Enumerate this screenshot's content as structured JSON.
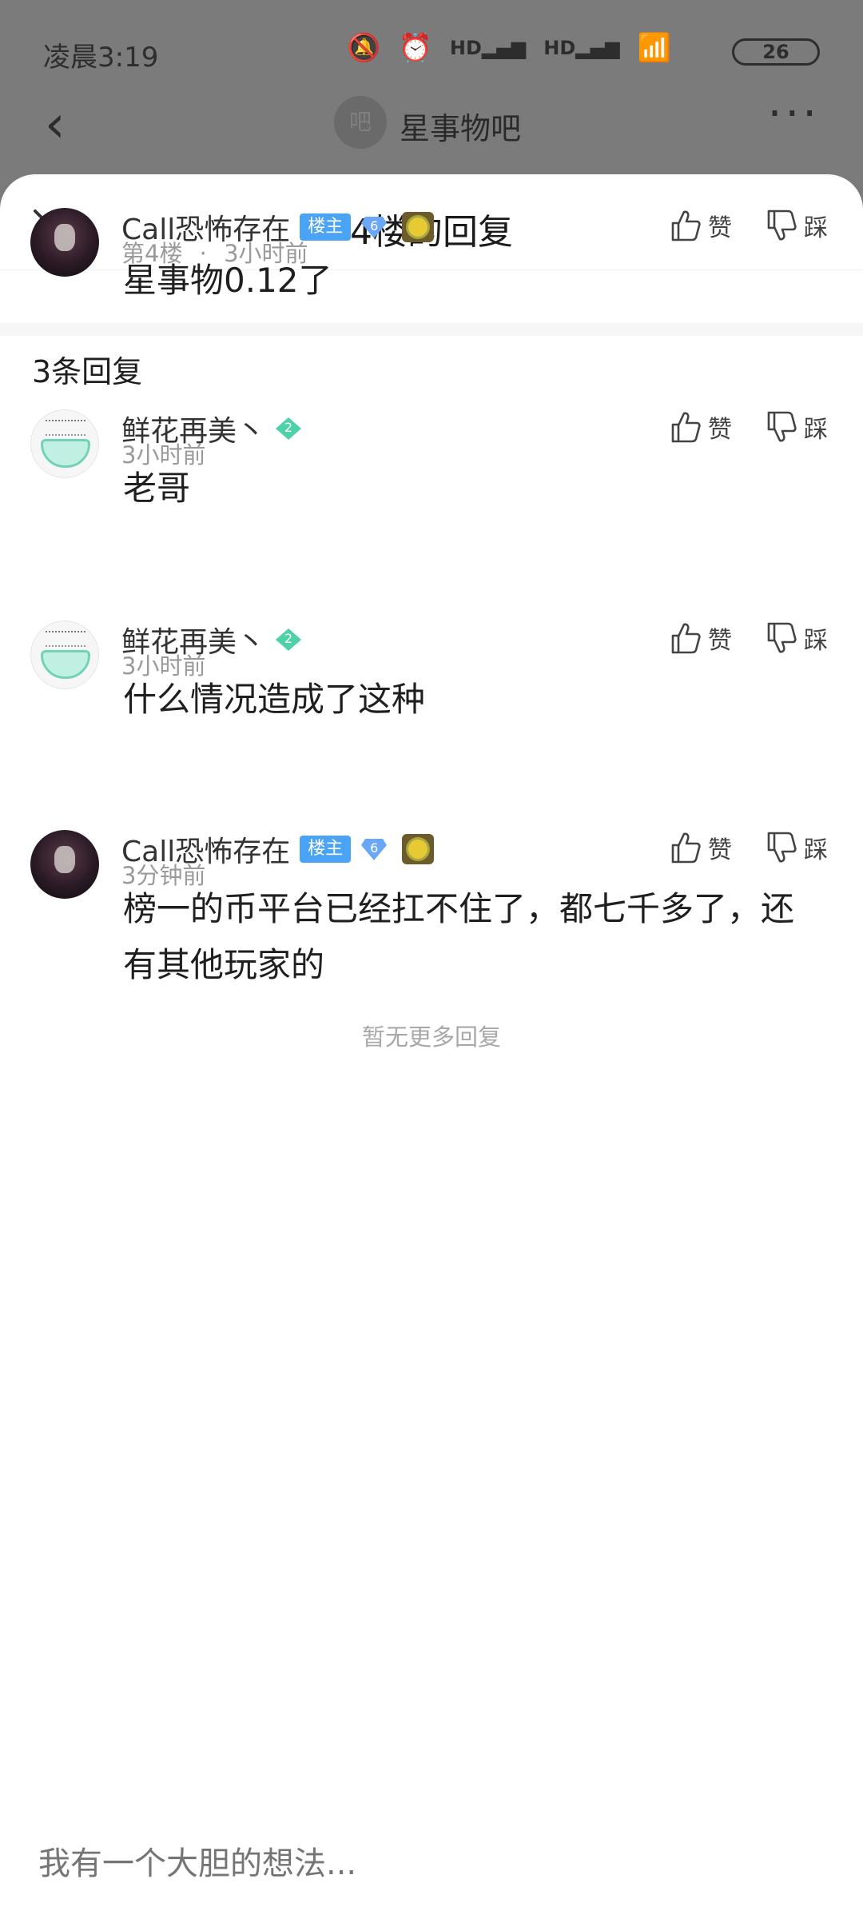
{
  "status_bar": {
    "time": "凌晨3:19",
    "battery": "26",
    "icons": [
      "mute-icon",
      "alarm-icon",
      "hd-signal-icon",
      "hd-signal-icon",
      "wifi-icon"
    ]
  },
  "background_page": {
    "forum_avatar_text": "吧",
    "forum_name": "星事物吧"
  },
  "sheet": {
    "title": "4楼的回复"
  },
  "main_comment": {
    "username": "Call恐怖存在",
    "badge": "楼主",
    "level": "6",
    "floor": "第4楼",
    "time_sep": "·",
    "time": "3小时前",
    "text": "星事物0.12了",
    "like_label": "赞",
    "dislike_label": "踩"
  },
  "reply_count": "3条回复",
  "replies": [
    {
      "username": "鲜花再美丶",
      "level": "2",
      "time": "3小时前",
      "text": "老哥",
      "like_label": "赞",
      "dislike_label": "踩"
    },
    {
      "username": "鲜花再美丶",
      "level": "2",
      "time": "3小时前",
      "text": "什么情况造成了这种",
      "like_label": "赞",
      "dislike_label": "踩"
    },
    {
      "username": "Call恐怖存在",
      "badge": "楼主",
      "level": "6",
      "time": "3分钟前",
      "text": "榜一的币平台已经扛不住了，都七千多了，还有其他玩家的",
      "like_label": "赞",
      "dislike_label": "踩"
    }
  ],
  "no_more": "暂无更多回复",
  "composer": {
    "placeholder": "我有一个大胆的想法..."
  },
  "colors": {
    "owner_badge": "#4ba3f6",
    "level_blue": "#6aa8f7",
    "level_green": "#4fd1a6",
    "overlay": "#7b7b7b"
  }
}
